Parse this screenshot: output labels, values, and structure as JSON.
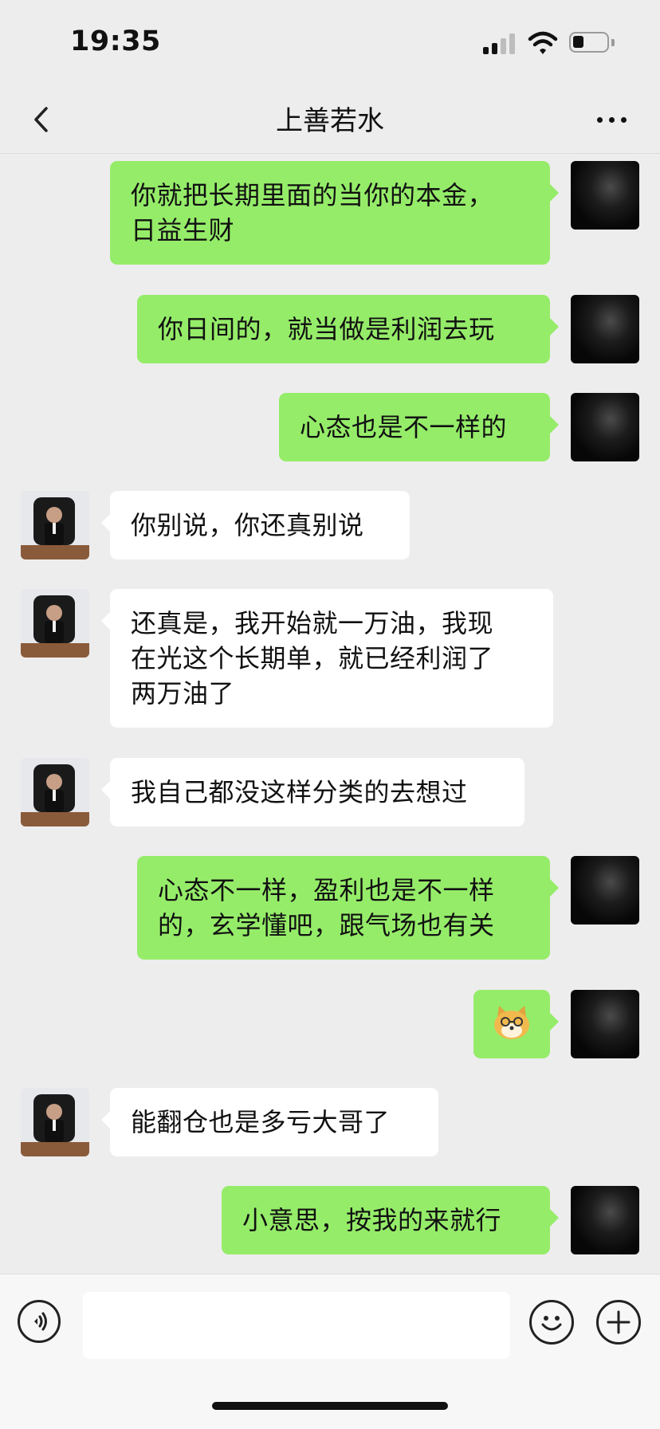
{
  "status_bar": {
    "time": "19:35"
  },
  "header": {
    "title": "上善若水"
  },
  "messages": [
    {
      "sender": "me",
      "text": "你就把长期里面的当你的本金，\n日益生财"
    },
    {
      "sender": "me",
      "text": "你日间的，就当做是利润去玩"
    },
    {
      "sender": "me",
      "text": "心态也是不一样的"
    },
    {
      "sender": "contact",
      "text": "你别说，你还真别说"
    },
    {
      "sender": "contact",
      "text": "还真是，我开始就一万油，我现\n在光这个长期单，就已经利润了\n两万油了"
    },
    {
      "sender": "contact",
      "text": "我自己都没这样分类的去想过"
    },
    {
      "sender": "me",
      "text": "心态不一样，盈利也是不一样\n的，玄学懂吧，跟气场也有关"
    },
    {
      "sender": "me",
      "sticker": "doge-emoji"
    },
    {
      "sender": "contact",
      "text": "能翻仓也是多亏大哥了"
    },
    {
      "sender": "me",
      "text": "小意思，按我的来就行"
    }
  ],
  "icons": {
    "back": "chevron-left-icon",
    "more": "more-dots-icon",
    "voice": "voice-icon",
    "emoji": "smile-icon",
    "plus": "plus-icon"
  },
  "colors": {
    "outgoing_bubble": "#95ec69",
    "incoming_bubble": "#ffffff",
    "background": "#ededed"
  }
}
